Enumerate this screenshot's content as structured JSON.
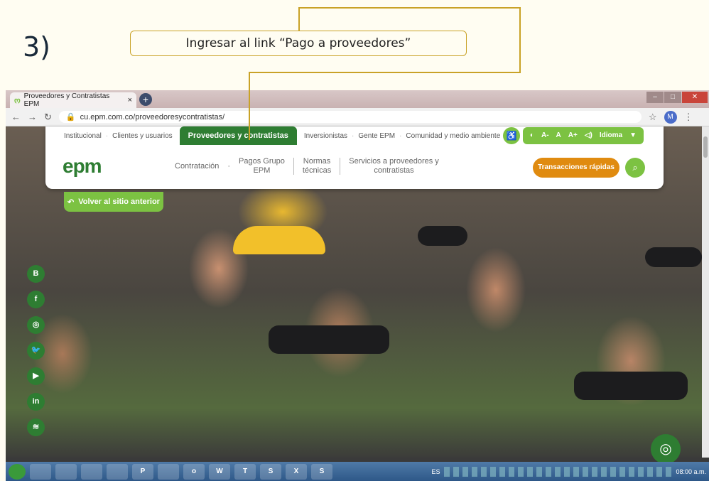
{
  "slide": {
    "step": "3)",
    "callout": "Ingresar al link “Pago a proveedores”",
    "accent": "#c9a227"
  },
  "browser": {
    "tab_title": "Proveedores y Contratistas EPM",
    "tab_close": "×",
    "new_tab": "+",
    "url": "cu.epm.com.co/proveedoresycontratistas/",
    "avatar": "M"
  },
  "site": {
    "brand_color": "#2e7d32",
    "accent_green": "#7cc242",
    "logo": "epm",
    "top_nav": [
      "Institucional",
      "Clientes y usuarios",
      "Proveedores y contratistas",
      "Inversionistas",
      "Gente EPM",
      "Comunidad y medio ambiente"
    ],
    "access": {
      "a_minus": "A-",
      "a": "A",
      "a_plus": "A+",
      "idioma": "Idioma"
    },
    "main_nav": {
      "contratacion": "Contratación",
      "pagos_line1": "Pagos Grupo",
      "pagos_line2": "EPM",
      "normas_line1": "Normas",
      "normas_line2": "técnicas",
      "servicios_line1": "Servicios a proveedores y",
      "servicios_line2": "contratistas"
    },
    "quick_button": "Transacciones rápidas",
    "back_button": "Volver al sitio anterior",
    "social": [
      "B",
      "f",
      "◎",
      "🐦",
      "▶",
      "in",
      "≋"
    ]
  },
  "taskbar": {
    "apps": [
      "",
      "",
      "",
      "",
      "",
      "P",
      "",
      "o",
      "W",
      "T",
      "S",
      "X",
      "S"
    ],
    "lang": "ES",
    "time": "08:00 a.m."
  }
}
